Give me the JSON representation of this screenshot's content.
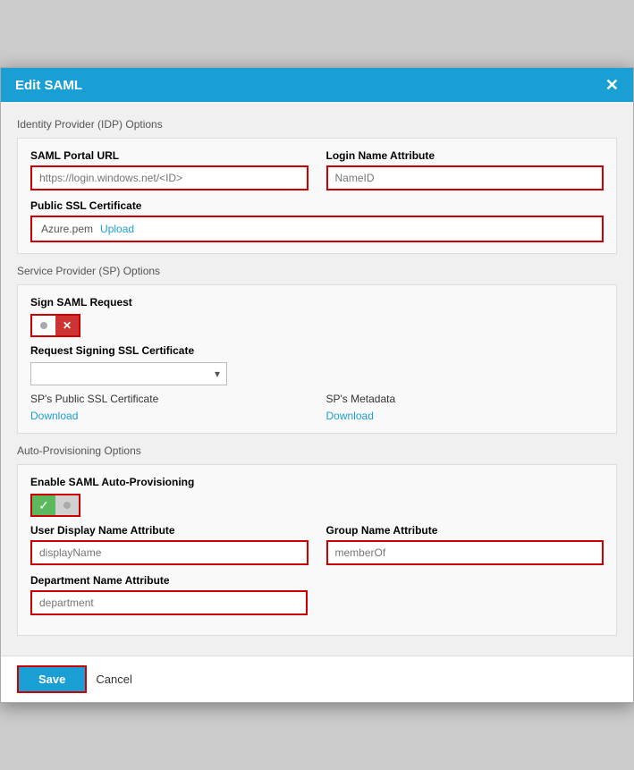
{
  "modal": {
    "title": "Edit SAML",
    "close_icon": "✕"
  },
  "sections": {
    "idp": {
      "label": "Identity Provider (IDP) Options",
      "saml_url_label": "SAML Portal URL",
      "saml_url_placeholder": "https://login.windows.net/<ID>",
      "login_name_label": "Login Name Attribute",
      "login_name_placeholder": "NameID",
      "ssl_cert_label": "Public SSL Certificate",
      "ssl_cert_filename": "Azure.pem",
      "ssl_cert_upload": "Upload"
    },
    "sp": {
      "label": "Service Provider (SP) Options",
      "sign_label": "Sign SAML Request",
      "signing_ssl_label": "Request Signing SSL Certificate",
      "signing_ssl_placeholder": "",
      "public_ssl_label": "SP's Public SSL Certificate",
      "public_ssl_download": "Download",
      "metadata_label": "SP's Metadata",
      "metadata_download": "Download"
    },
    "auto": {
      "label": "Auto-Provisioning Options",
      "enable_label": "Enable SAML Auto-Provisioning",
      "user_display_label": "User Display Name Attribute",
      "user_display_placeholder": "displayName",
      "group_name_label": "Group Name Attribute",
      "group_name_placeholder": "memberOf",
      "dept_label": "Department Name Attribute",
      "dept_placeholder": "department"
    }
  },
  "footer": {
    "save_label": "Save",
    "cancel_label": "Cancel"
  }
}
